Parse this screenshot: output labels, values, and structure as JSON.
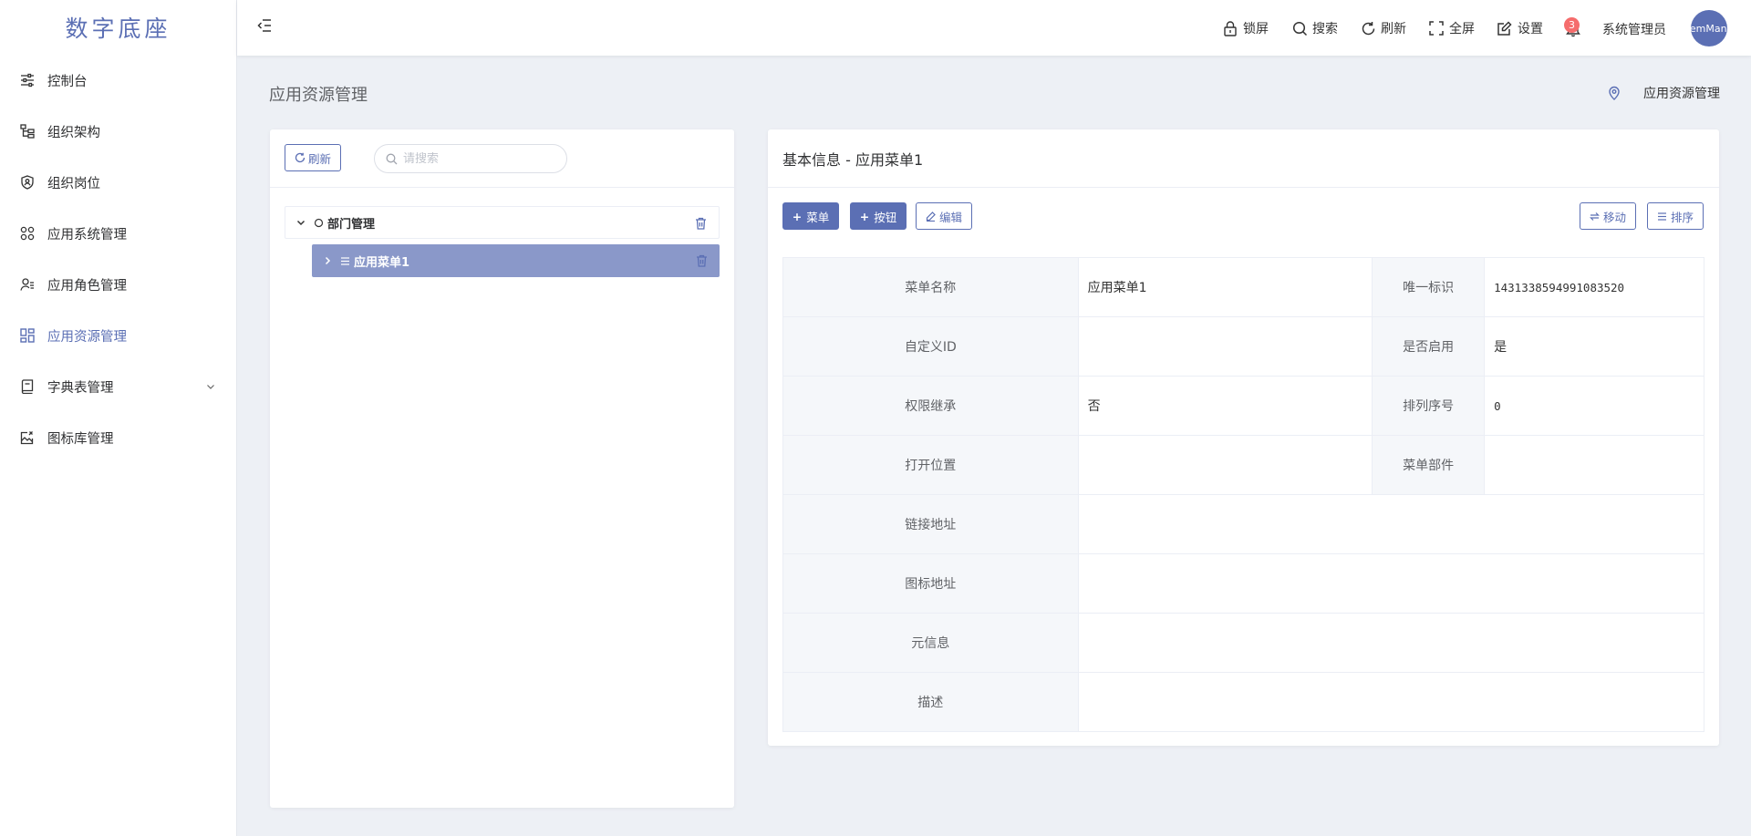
{
  "app": {
    "logo_text": "数字底座"
  },
  "sidebar": {
    "items": [
      {
        "label": "控制台",
        "icon": "sliders-icon"
      },
      {
        "label": "组织架构",
        "icon": "org-tree-icon"
      },
      {
        "label": "组织岗位",
        "icon": "shield-user-icon"
      },
      {
        "label": "应用系统管理",
        "icon": "apps-grid-icon"
      },
      {
        "label": "应用角色管理",
        "icon": "user-list-icon"
      },
      {
        "label": "应用资源管理",
        "icon": "dashboard-grid-icon",
        "active": true
      },
      {
        "label": "字典表管理",
        "icon": "book-icon",
        "has_children": true
      },
      {
        "label": "图标库管理",
        "icon": "image-edit-icon"
      }
    ]
  },
  "header": {
    "tools": [
      {
        "label": "锁屏",
        "icon": "lock-icon"
      },
      {
        "label": "搜索",
        "icon": "search-icon"
      },
      {
        "label": "刷新",
        "icon": "refresh-icon"
      },
      {
        "label": "全屏",
        "icon": "fullscreen-icon"
      },
      {
        "label": "设置",
        "icon": "settings-edit-icon"
      }
    ],
    "notification_count": "3",
    "user_name": "系统管理员",
    "avatar_text": "SystemManager"
  },
  "page": {
    "title": "应用资源管理",
    "breadcrumb": "应用资源管理"
  },
  "tree_panel": {
    "refresh_label": "刷新",
    "search_placeholder": "请搜索",
    "root_label": "部门管理",
    "child_label": "应用菜单1"
  },
  "detail": {
    "title": "基本信息 - 应用菜单1",
    "buttons": {
      "add_menu": "菜单",
      "add_button": "按钮",
      "edit": "编辑",
      "move": "移动",
      "sort": "排序"
    },
    "fields": {
      "menu_name_label": "菜单名称",
      "menu_name_value": "应用菜单1",
      "unique_id_label": "唯一标识",
      "unique_id_value": "1431338594991083520",
      "custom_id_label": "自定义ID",
      "custom_id_value": "",
      "enabled_label": "是否启用",
      "enabled_value": "是",
      "inherit_label": "权限继承",
      "inherit_value": "否",
      "order_label": "排列序号",
      "order_value": "0",
      "open_pos_label": "打开位置",
      "open_pos_value": "",
      "component_label": "菜单部件",
      "component_value": "",
      "link_label": "链接地址",
      "link_value": "",
      "icon_addr_label": "图标地址",
      "icon_addr_value": "",
      "meta_label": "元信息",
      "meta_value": "",
      "desc_label": "描述",
      "desc_value": ""
    }
  },
  "colors": {
    "accent": "#5b6fb4",
    "selected_node": "#8a98c9",
    "badge": "#f56c6c"
  }
}
